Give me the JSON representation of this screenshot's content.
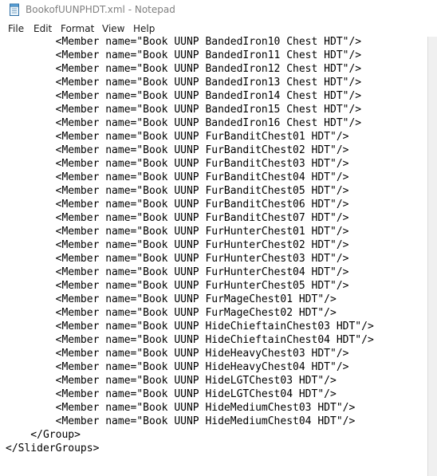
{
  "window": {
    "title": "BookofUUNPHDT.xml - Notepad",
    "icon": "notepad-icon"
  },
  "menu": {
    "items": [
      {
        "label": "File"
      },
      {
        "label": "Edit"
      },
      {
        "label": "Format"
      },
      {
        "label": "View"
      },
      {
        "label": "Help"
      }
    ]
  },
  "editor": {
    "lines": [
      "\t<Member name=\"Book UUNP BandedIron10 Chest HDT\"/>",
      "\t<Member name=\"Book UUNP BandedIron11 Chest HDT\"/>",
      "\t<Member name=\"Book UUNP BandedIron12 Chest HDT\"/>",
      "\t<Member name=\"Book UUNP BandedIron13 Chest HDT\"/>",
      "\t<Member name=\"Book UUNP BandedIron14 Chest HDT\"/>",
      "\t<Member name=\"Book UUNP BandedIron15 Chest HDT\"/>",
      "\t<Member name=\"Book UUNP BandedIron16 Chest HDT\"/>",
      "\t<Member name=\"Book UUNP FurBanditChest01 HDT\"/>",
      "\t<Member name=\"Book UUNP FurBanditChest02 HDT\"/>",
      "\t<Member name=\"Book UUNP FurBanditChest03 HDT\"/>",
      "\t<Member name=\"Book UUNP FurBanditChest04 HDT\"/>",
      "\t<Member name=\"Book UUNP FurBanditChest05 HDT\"/>",
      "\t<Member name=\"Book UUNP FurBanditChest06 HDT\"/>",
      "\t<Member name=\"Book UUNP FurBanditChest07 HDT\"/>",
      "\t<Member name=\"Book UUNP FurHunterChest01 HDT\"/>",
      "\t<Member name=\"Book UUNP FurHunterChest02 HDT\"/>",
      "\t<Member name=\"Book UUNP FurHunterChest03 HDT\"/>",
      "\t<Member name=\"Book UUNP FurHunterChest04 HDT\"/>",
      "\t<Member name=\"Book UUNP FurHunterChest05 HDT\"/>",
      "\t<Member name=\"Book UUNP FurMageChest01 HDT\"/>",
      "\t<Member name=\"Book UUNP FurMageChest02 HDT\"/>",
      "\t<Member name=\"Book UUNP HideChieftainChest03 HDT\"/>",
      "\t<Member name=\"Book UUNP HideChieftainChest04 HDT\"/>",
      "\t<Member name=\"Book UUNP HideHeavyChest03 HDT\"/>",
      "\t<Member name=\"Book UUNP HideHeavyChest04 HDT\"/>",
      "\t<Member name=\"Book UUNP HideLGTChest03 HDT\"/>",
      "\t<Member name=\"Book UUNP HideLGTChest04 HDT\"/>",
      "\t<Member name=\"Book UUNP HideMediumChest03 HDT\"/>",
      "\t<Member name=\"Book UUNP HideMediumChest04 HDT\"/>",
      "    </Group>",
      "</SliderGroups>"
    ]
  }
}
